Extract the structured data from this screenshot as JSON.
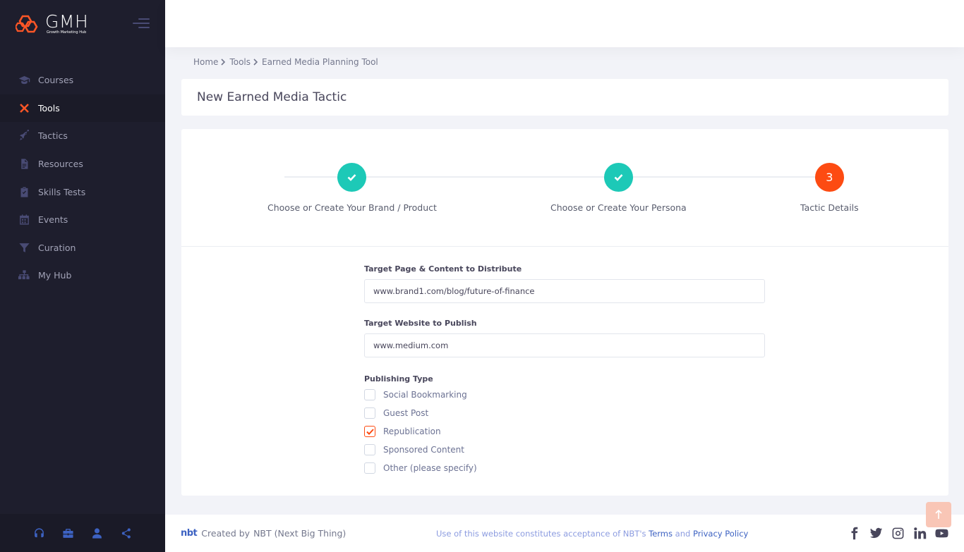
{
  "brand": {
    "name": "GMH",
    "tagline": "Growth Marketing Hub"
  },
  "sidebar": {
    "items": [
      {
        "label": "Courses",
        "icon": "graduation-cap-icon",
        "active": false
      },
      {
        "label": "Tools",
        "icon": "tools-icon",
        "active": true
      },
      {
        "label": "Tactics",
        "icon": "rocket-icon",
        "active": false
      },
      {
        "label": "Resources",
        "icon": "file-icon",
        "active": false
      },
      {
        "label": "Skills Tests",
        "icon": "clipboard-check-icon",
        "active": false
      },
      {
        "label": "Events",
        "icon": "calendar-icon",
        "active": false
      },
      {
        "label": "Curation",
        "icon": "filter-icon",
        "active": false
      },
      {
        "label": "My Hub",
        "icon": "sitemap-icon",
        "active": false
      }
    ],
    "footer_icons": [
      "headset-icon",
      "briefcase-icon",
      "user-icon",
      "share-icon"
    ]
  },
  "breadcrumb": {
    "home": "Home",
    "tools": "Tools",
    "current": "Earned Media Planning Tool"
  },
  "page_title": "New Earned Media Tactic",
  "stepper": {
    "steps": [
      {
        "label": "Choose or Create Your Brand / Product",
        "state": "done"
      },
      {
        "label": "Choose or Create Your Persona",
        "state": "done"
      },
      {
        "label": "Tactic Details",
        "state": "current",
        "number": "3"
      }
    ]
  },
  "form": {
    "target_page_label": "Target Page & Content to Distribute",
    "target_page_value": "www.brand1.com/blog/future-of-finance",
    "target_site_label": "Target Website to Publish",
    "target_site_value": "www.medium.com",
    "publishing_type_label": "Publishing Type",
    "publishing_options": [
      {
        "label": "Social Bookmarking",
        "checked": false
      },
      {
        "label": "Guest Post",
        "checked": false
      },
      {
        "label": "Republication",
        "checked": true
      },
      {
        "label": "Sponsored Content",
        "checked": false
      },
      {
        "label": "Other (please specify)",
        "checked": false
      }
    ]
  },
  "footer": {
    "logo_text": "nbt",
    "created_by": "Created by",
    "company": "NBT (Next Big Thing)",
    "notice": "Use of this website constitutes acceptance of NBT's",
    "terms": "Terms",
    "and": "and",
    "privacy": "Privacy Policy",
    "social_icons": [
      "facebook-icon",
      "twitter-icon",
      "instagram-icon",
      "linkedin-icon",
      "youtube-icon"
    ]
  },
  "colors": {
    "accent": "#fd4b12",
    "success": "#1dc9b7",
    "sidebar_bg": "#1e1e2d",
    "link": "#3d62c2"
  }
}
